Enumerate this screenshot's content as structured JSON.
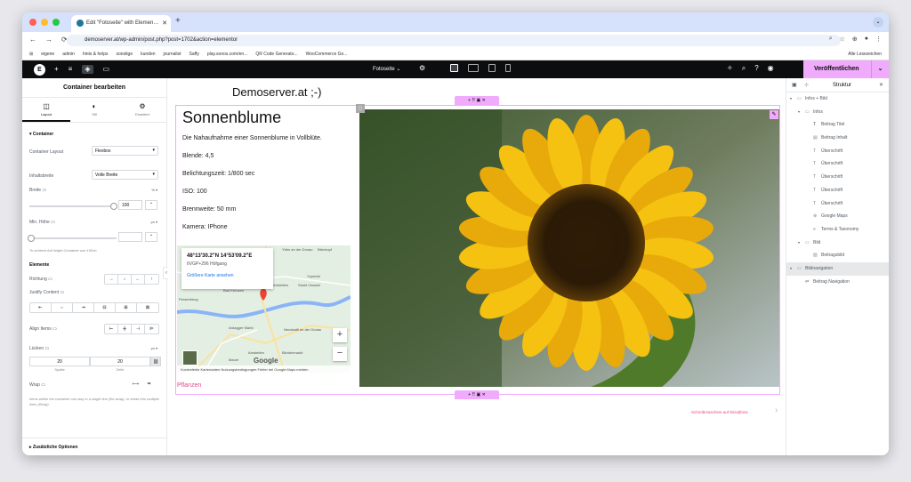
{
  "browser": {
    "tab_title": "Edit \"Fotoseite\" with Elemen…",
    "url": "demoserver.at/wp-admin/post.php?post=1702&action=elementor",
    "bookmarks": [
      "eigene",
      "admin",
      "hints & helps",
      "sonstige",
      "kunden",
      "journalist",
      "Saffy",
      "play.sonos.com/en...",
      "QR Code Generato...",
      "WooCommerce Go..."
    ],
    "bookmarks_all": "Alle Lesezeichen"
  },
  "topbar": {
    "page_name": "Fotoseite",
    "publish_label": "Veröffentlichen"
  },
  "panel": {
    "title": "Container bearbeiten",
    "tabs": [
      "Layout",
      "Stil",
      "Erweitert"
    ],
    "section_container": "Container",
    "container_layout_label": "Container Layout",
    "container_layout_value": "Flexbox",
    "inhaltsbreite_label": "Inhaltsbreite",
    "inhaltsbreite_value": "Volle Breite",
    "breite_label": "Breite",
    "breite_unit": "% ▾",
    "breite_value": "100",
    "min_hoehe_label": "Min. Höhe",
    "min_hoehe_unit": "px ▾",
    "min_hoehe_value": "",
    "min_hoehe_note": "To achieve full height Container use 100vh.",
    "elemente_label": "Elemente",
    "richtung_label": "Richtung",
    "justify_label": "Justify Content",
    "align_label": "Align Items",
    "luecken_label": "Lücken",
    "luecken_unit": "px ▾",
    "gap_spalte": "20",
    "gap_zeile": "20",
    "gap_spalte_label": "Spalte",
    "gap_zeile_label": "Zeile",
    "wrap_label": "Wrap",
    "wrap_note": "Items within the container can stay in a single line (No wrap), or break into multiple lines (Wrap).",
    "more_options": "Zusätzliche Optionen"
  },
  "canvas": {
    "site_title": "Demoserver.at ;-)",
    "post_title": "Sonnenblume",
    "post_content": "Die Nahaufnahme einer Sonnenblume in Vollblüte.",
    "fields": [
      "Blende: 4,5",
      "Belichtungszeit: 1/800 sec",
      "ISO: 100",
      "Brennweite: 50 mm",
      "Kamera: IPhone"
    ],
    "map": {
      "coords": "48°13'30.2\"N 14°53'09.2\"E",
      "pluscode": "6VGP+296 Höfgang",
      "larger_map": "Größere Karte ansehen",
      "places": [
        "Ybbs an der Donau",
        "Bad Kreuzen",
        "Persenbeug",
        "Artstetten",
        "Sankt Oswald",
        "Ardagger Markt",
        "Neustadtl an der Donau",
        "Amstetten",
        "Blindenmarkt",
        "Mauer",
        "Yspertal",
        "Bärnkopf"
      ],
      "logo": "Google",
      "footer": "Kurzbefehle   Kartendaten   Nutzungsbedingungen   Fehler bei Google Maps melden"
    },
    "category_link": "Pflanzen",
    "next_post": "Schreibmaschine auf Ibiza|Ibiza"
  },
  "structure": {
    "title": "Struktur",
    "items": [
      {
        "label": "Infos + Bild",
        "level": 0,
        "arrow": "▾",
        "icon": "container-icon"
      },
      {
        "label": "Infos",
        "level": 1,
        "arrow": "▾",
        "icon": "container-icon"
      },
      {
        "label": "Beitrag Titel",
        "level": 2,
        "arrow": "",
        "icon": "title-icon"
      },
      {
        "label": "Beitrag Inhalt",
        "level": 2,
        "arrow": "",
        "icon": "content-icon"
      },
      {
        "label": "Überschrift",
        "level": 2,
        "arrow": "",
        "icon": "heading-icon"
      },
      {
        "label": "Überschrift",
        "level": 2,
        "arrow": "",
        "icon": "heading-icon"
      },
      {
        "label": "Überschrift",
        "level": 2,
        "arrow": "",
        "icon": "heading-icon"
      },
      {
        "label": "Überschrift",
        "level": 2,
        "arrow": "",
        "icon": "heading-icon"
      },
      {
        "label": "Überschrift",
        "level": 2,
        "arrow": "",
        "icon": "heading-icon"
      },
      {
        "label": "Google Maps",
        "level": 2,
        "arrow": "",
        "icon": "map-icon"
      },
      {
        "label": "Terms & Taxonomy",
        "level": 2,
        "arrow": "",
        "icon": "terms-icon"
      },
      {
        "label": "Bild",
        "level": 1,
        "arrow": "▾",
        "icon": "container-icon"
      },
      {
        "label": "Beitragsbild",
        "level": 2,
        "arrow": "",
        "icon": "image-icon"
      },
      {
        "label": "Bildnavigation",
        "level": 0,
        "arrow": "▾",
        "icon": "container-icon",
        "selected": true
      },
      {
        "label": "Beitrag Navigation",
        "level": 1,
        "arrow": "",
        "icon": "navigation-icon"
      }
    ]
  },
  "colors": {
    "accent": "#f0abfc",
    "link": "#e2498a",
    "topbar": "#0c0d0e"
  }
}
